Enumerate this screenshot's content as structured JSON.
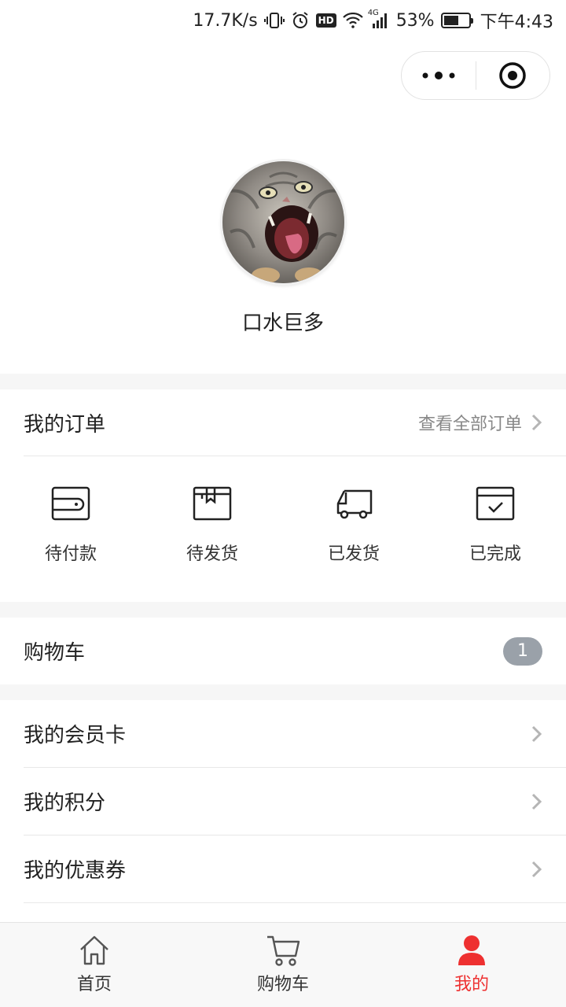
{
  "status_bar": {
    "network_speed": "17.7K/s",
    "hd_label": "HD",
    "network_type": "4G",
    "battery_percent": "53%",
    "time": "下午4:43"
  },
  "profile": {
    "username": "口水巨多",
    "avatar_icon": "cat-avatar"
  },
  "orders_section": {
    "title": "我的订单",
    "view_all": "查看全部订单",
    "items": [
      {
        "label": "待付款",
        "icon": "wallet-icon"
      },
      {
        "label": "待发货",
        "icon": "package-icon"
      },
      {
        "label": "已发货",
        "icon": "truck-icon"
      },
      {
        "label": "已完成",
        "icon": "completed-icon"
      }
    ]
  },
  "cart_row": {
    "title": "购物车",
    "count": "1"
  },
  "menu": [
    {
      "label": "我的会员卡"
    },
    {
      "label": "我的积分"
    },
    {
      "label": "我的优惠券"
    }
  ],
  "tabbar": {
    "tabs": [
      {
        "label": "首页",
        "icon": "home-icon"
      },
      {
        "label": "购物车",
        "icon": "cart-icon"
      },
      {
        "label": "我的",
        "icon": "user-icon"
      }
    ],
    "active_color": "#ee3030"
  }
}
